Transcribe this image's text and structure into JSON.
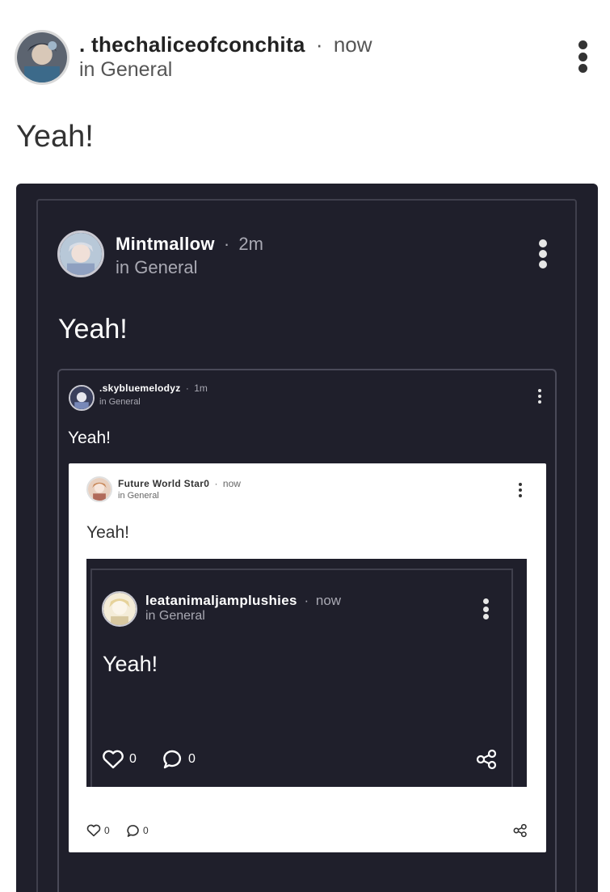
{
  "outer_post": {
    "author": ". thechaliceofconchita",
    "time": "now",
    "community": "in General",
    "body": "Yeah!"
  },
  "level1_post": {
    "author": "Mintmallow",
    "time": "2m",
    "community": "in General",
    "body": "Yeah!"
  },
  "level2_post": {
    "author": ".skybluemelodyz",
    "time": "1m",
    "community": "in General",
    "body": "Yeah!"
  },
  "level3_post": {
    "author": "Future World Star0",
    "time": "now",
    "community": "in General",
    "body": "Yeah!",
    "like_count": "0",
    "comment_count": "0"
  },
  "level4_post": {
    "author": "leatanimaljamplushies",
    "time": "now",
    "community": "in General",
    "body": "Yeah!",
    "like_count": "0",
    "comment_count": "0"
  },
  "separator": "·",
  "colors": {
    "dark_bg": "#1f1f2b",
    "dark_border": "#4a4a58",
    "light_text": "#ffffff",
    "muted_dark": "#a9a9b3",
    "text_dark": "#333333",
    "muted_light": "#666666"
  },
  "icons": [
    "avatar-image",
    "kebab-menu-icon",
    "heart-icon",
    "comment-icon",
    "share-icon"
  ]
}
